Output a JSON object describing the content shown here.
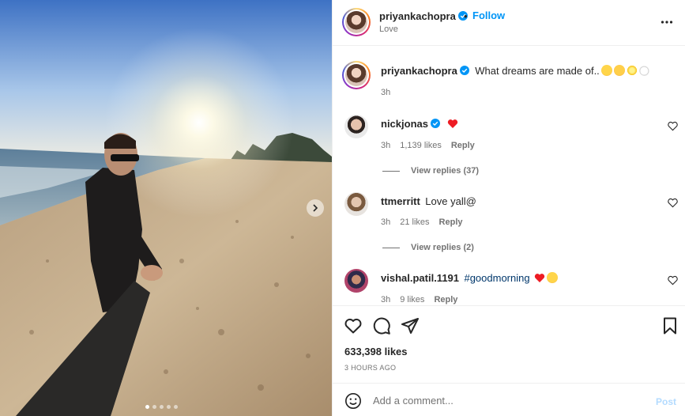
{
  "post": {
    "author": "priyankachopra",
    "follow_label": "Follow",
    "dot": "•",
    "location": "Love",
    "caption_text": "What dreams are made of..",
    "caption_time": "3h",
    "carousel_count": 5,
    "carousel_active": 0
  },
  "comments": [
    {
      "user": "nickjonas",
      "verified": true,
      "text": "",
      "time": "3h",
      "likes": "1,139 likes",
      "reply_label": "Reply",
      "view_replies": "View replies (37)"
    },
    {
      "user": "ttmerritt",
      "verified": false,
      "text": "Love yall@",
      "time": "3h",
      "likes": "21 likes",
      "reply_label": "Reply",
      "view_replies": "View replies (2)"
    },
    {
      "user": "vishal.patil.1191",
      "verified": false,
      "text": "#goodmorning",
      "time": "3h",
      "likes": "9 likes",
      "reply_label": "Reply"
    }
  ],
  "actions": {
    "likes": "633,398 likes",
    "time_ago": "3 HOURS AGO"
  },
  "add_comment": {
    "placeholder": "Add a comment...",
    "post_label": "Post"
  },
  "colors": {
    "accent": "#0095f6",
    "verified": "#0095f6",
    "heart_red": "#ed4956",
    "hashtag": "#00376b"
  }
}
